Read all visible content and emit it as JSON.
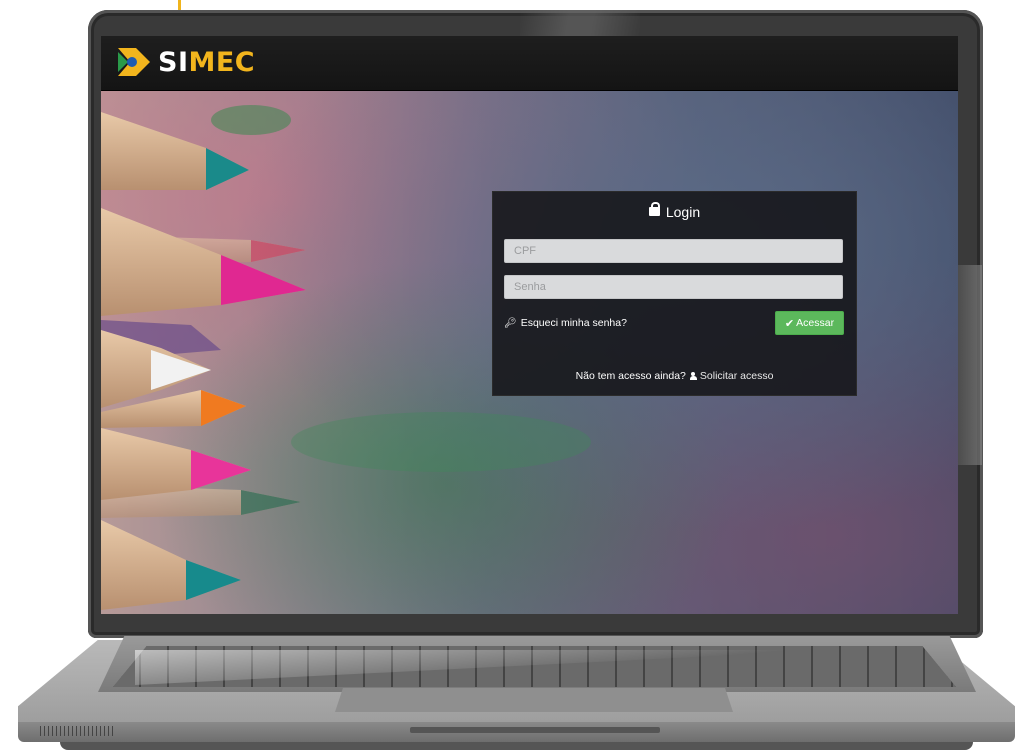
{
  "app": {
    "logo": {
      "prefix": "SI",
      "suffix": "MEC",
      "icon": "simec-logo-icon"
    }
  },
  "login": {
    "title": "Login",
    "title_icon": "lock-icon",
    "cpf_placeholder": "CPF",
    "senha_placeholder": "Senha",
    "forgot_icon": "key-icon",
    "forgot_label": "Esqueci minha senha?",
    "submit_icon": "check-icon",
    "submit_label": "Acessar",
    "no_access_text": "Não tem acesso ainda?",
    "request_icon": "user-icon",
    "request_label": "Solicitar acesso"
  },
  "colors": {
    "brand_yellow": "#f2b51d",
    "button_green": "#5cb85c",
    "panel_bg": "#141418"
  }
}
